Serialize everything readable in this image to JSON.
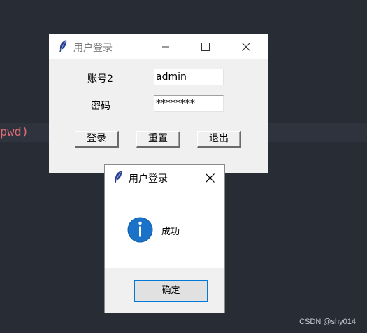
{
  "editor": {
    "code_fragment": "pwd)"
  },
  "watermark": "CSDN @shy014",
  "login_window": {
    "title": "用户登录",
    "icon": "feather-icon",
    "username_label": "账号2",
    "username_value": "admin",
    "password_label": "密码",
    "password_value": "********",
    "buttons": {
      "login": "登录",
      "reset": "重置",
      "quit": "退出"
    }
  },
  "message_box": {
    "title": "用户登录",
    "icon": "info-icon",
    "message": "成功",
    "ok_label": "确定",
    "accent_color": "#0078d7"
  }
}
